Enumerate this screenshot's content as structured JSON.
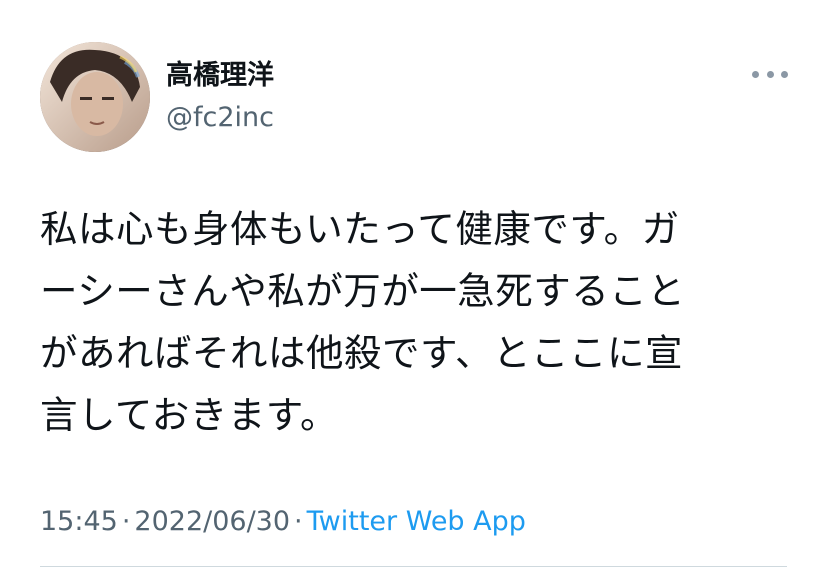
{
  "author": {
    "display_name": "高橋理洋",
    "handle": "@fc2inc"
  },
  "tweet": {
    "text": "私は心も身体もいたって健康です。ガ\nーシーさんや私が万が一急死すること\nがあればそれは他殺です、とここに宣\n言しておきます。",
    "time": "15:45",
    "date": "2022/06/30",
    "separator": "·",
    "source": "Twitter Web App"
  },
  "icons": {
    "more": "more-options-icon",
    "avatar": "profile-avatar"
  },
  "colors": {
    "primary_text": "#0f1419",
    "secondary_text": "#536471",
    "link": "#1d9bf0"
  }
}
